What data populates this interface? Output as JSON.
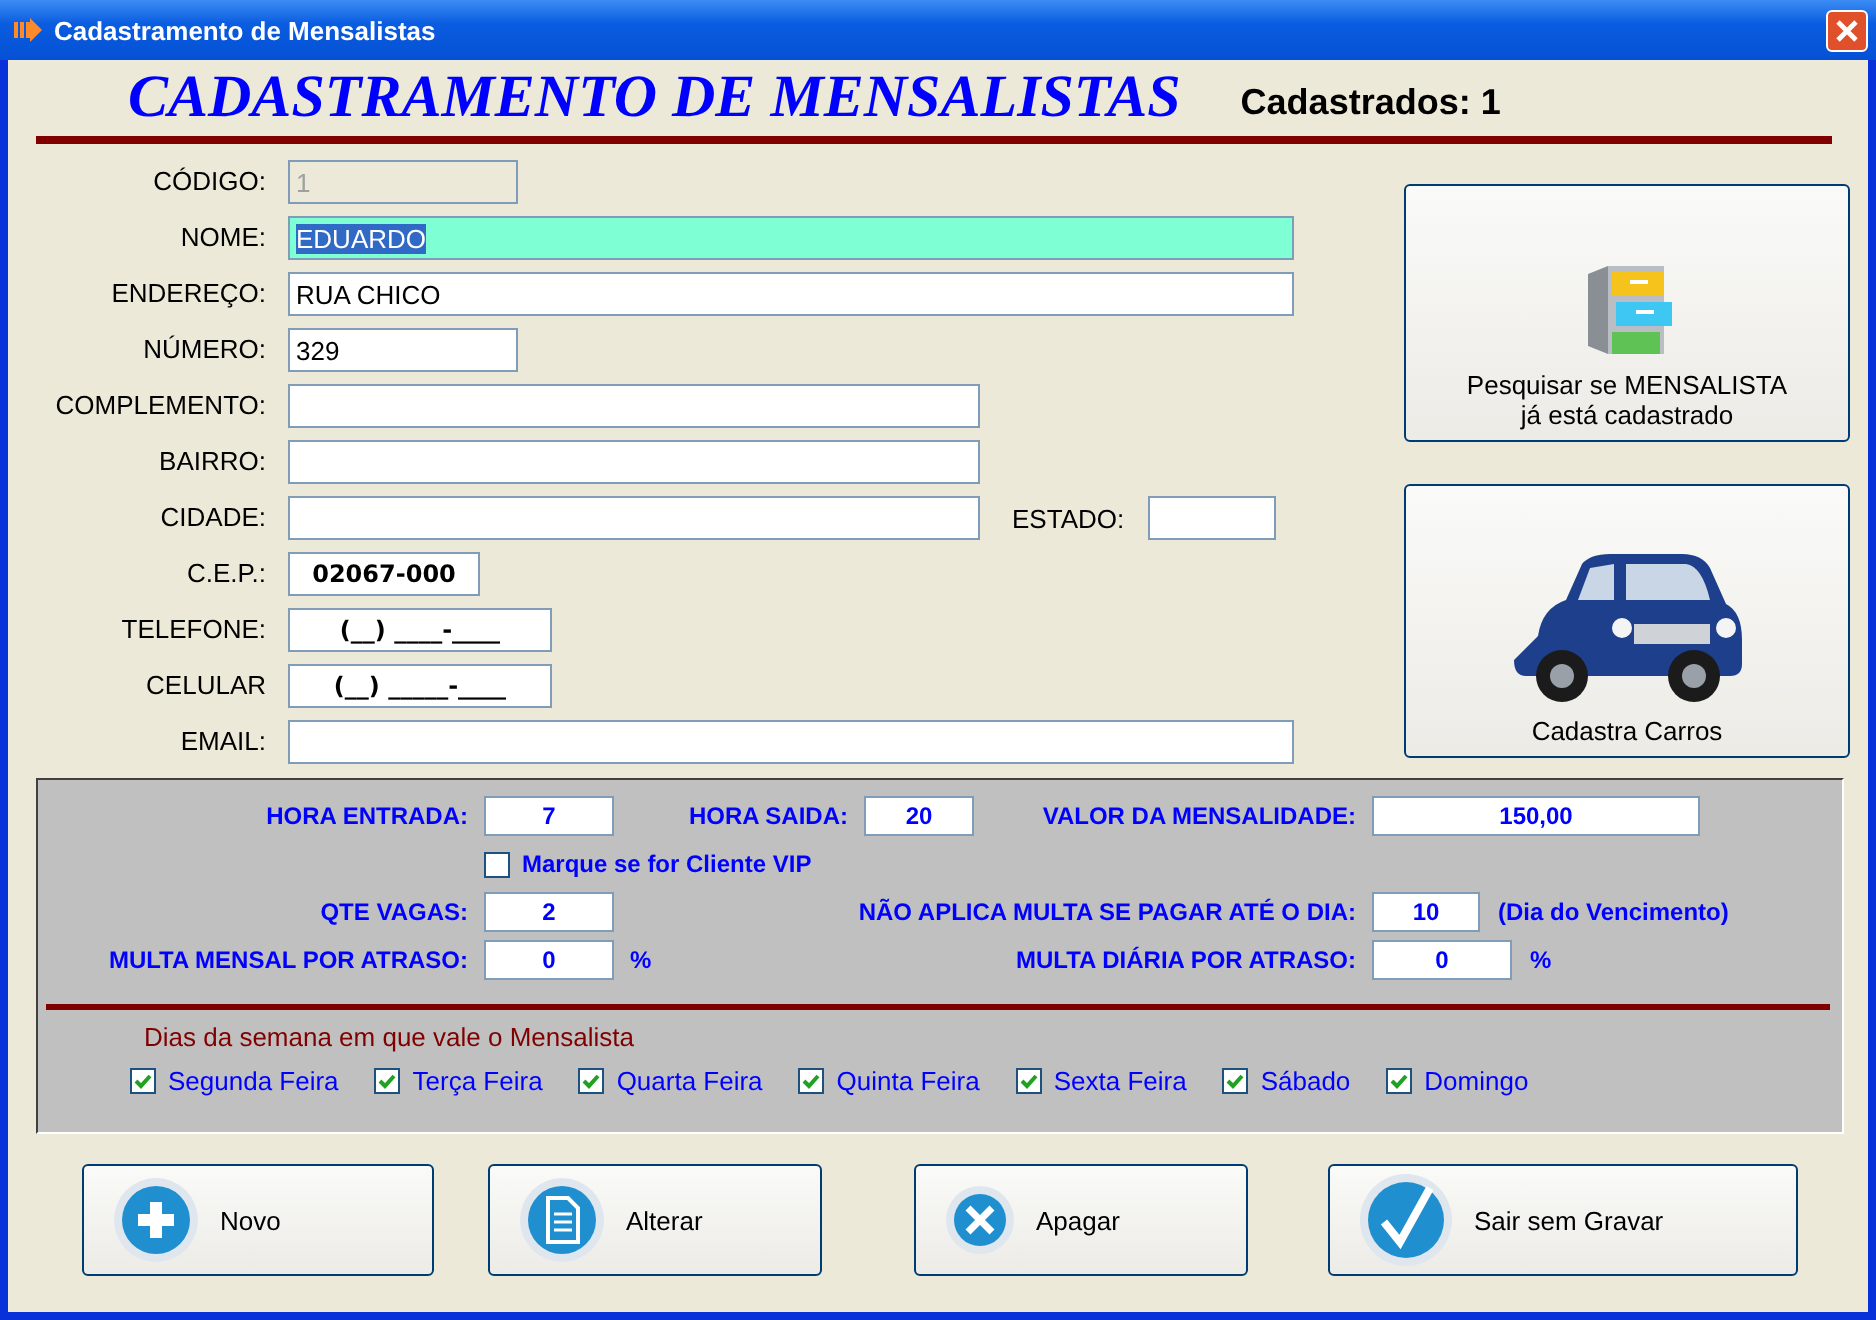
{
  "window": {
    "title": "Cadastramento de Mensalistas"
  },
  "heading": "CADASTRAMENTO DE MENSALISTAS",
  "registered": "Cadastrados: 1",
  "fields": [
    {
      "label": "CÓDIGO:",
      "value": "1",
      "kind": "text",
      "disabled": true,
      "focused": false
    },
    {
      "label": "NOME:",
      "value": "EDUARDO",
      "kind": "text",
      "disabled": false,
      "focused": true
    },
    {
      "label": "ENDEREÇO:",
      "value": "RUA CHICO",
      "kind": "text",
      "disabled": false,
      "focused": false
    },
    {
      "label": "NÚMERO:",
      "value": "329",
      "kind": "text",
      "disabled": false,
      "focused": false
    },
    {
      "label": "COMPLEMENTO:",
      "kind": "text",
      "disabled": false,
      "focused": false
    },
    {
      "label": "BAIRRO:",
      "kind": "text",
      "disabled": false,
      "focused": false
    },
    {
      "label": "CIDADE:",
      "kind": "text",
      "disabled": false,
      "focused": false,
      "side": {
        "label": "ESTADO:"
      }
    },
    {
      "label": "C.E.P.:",
      "value": "02067-000",
      "kind": "masked",
      "disabled": false,
      "focused": false
    },
    {
      "label": "TELEFONE:",
      "value": "(__) ____-____",
      "kind": "masked",
      "disabled": false,
      "focused": false
    },
    {
      "label": "CELULAR",
      "value": "(__) _____-____",
      "kind": "masked",
      "disabled": false,
      "focused": false
    },
    {
      "label": "EMAIL:",
      "kind": "text",
      "disabled": false,
      "focused": false
    }
  ],
  "side_buttons": [
    {
      "label": "Pesquisar se MENSALISTA já está cadastrado"
    },
    {
      "label": "Cadastra Carros"
    }
  ],
  "plan": {
    "hora_entrada": {
      "label": "HORA ENTRADA:",
      "value": "7"
    },
    "hora_saida": {
      "label": "HORA SAIDA:",
      "value": "20"
    },
    "valor": {
      "label": "VALOR DA MENSALIDADE:",
      "value": "150,00"
    },
    "vip": {
      "label": "Marque se for Cliente VIP",
      "checked": false
    },
    "vagas": {
      "label": "QTE VAGAS:",
      "value": "2"
    },
    "dia": {
      "label": "NÃO APLICA MULTA SE PAGAR ATÉ O DIA:",
      "value": "10",
      "note": "(Dia do Vencimento)"
    },
    "multa_mensal": {
      "label": "MULTA MENSAL POR ATRASO:",
      "value": "0",
      "unit": "%"
    },
    "multa_diaria": {
      "label": "MULTA DIÁRIA POR ATRASO:",
      "value": "0",
      "unit": "%"
    },
    "days_title": "Dias da semana em que vale o Mensalista",
    "days": [
      {
        "label": "Segunda Feira",
        "checked": true
      },
      {
        "label": "Terça Feira",
        "checked": true
      },
      {
        "label": "Quarta Feira",
        "checked": true
      },
      {
        "label": "Quinta Feira",
        "checked": true
      },
      {
        "label": "Sexta Feira",
        "checked": true
      },
      {
        "label": "Sábado",
        "checked": true
      },
      {
        "label": "Domingo",
        "checked": true
      }
    ]
  },
  "buttons": [
    {
      "label": "Novo"
    },
    {
      "label": "Alterar"
    },
    {
      "label": "Apagar"
    },
    {
      "label": "Sair sem Gravar"
    }
  ]
}
